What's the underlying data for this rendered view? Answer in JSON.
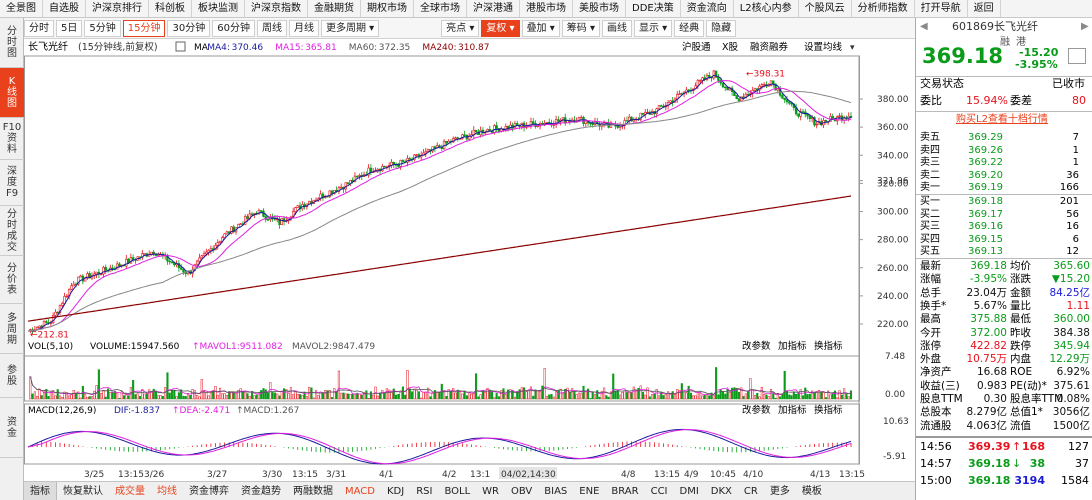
{
  "menu": [
    "全景图",
    "自选股",
    "沪深京排行",
    "科创板",
    "板块监测",
    "沪深京指数",
    "金融期货",
    "期权市场",
    "全球市场",
    "沪深港通",
    "港股市场",
    "美股市场",
    "DDE决策",
    "资金流向",
    "L2核心内参",
    "个股风云",
    "分析师指数",
    "打开导航",
    "返回"
  ],
  "left_tabs": [
    "分时图",
    "K线图",
    "F10资料",
    "深度F9",
    "分时成交",
    "分价表",
    "多周期",
    "参股",
    "资金"
  ],
  "toolbar": {
    "items": [
      "分时",
      "5日",
      "5分钟",
      "15分钟",
      "30分钟",
      "60分钟",
      "周线",
      "月线",
      "更多周期"
    ],
    "selected": "15分钟",
    "right_items": [
      "亮点",
      "复权",
      "叠加",
      "筹码",
      "画线",
      "显示",
      "经典",
      "隐藏"
    ]
  },
  "chart": {
    "stock_name": "长飞光纤",
    "period_note": "(15分钟线,前复权)",
    "ma": [
      {
        "label": "MA",
        "value": "",
        "color": "#000"
      },
      {
        "label": "MA4:",
        "value": "370.46",
        "color": "#1a1aa0"
      },
      {
        "label": "MA15:",
        "value": "365.81",
        "color": "#e020e0"
      },
      {
        "label": "MA60:",
        "value": "372.35",
        "color": "#555"
      },
      {
        "label": "MA240:",
        "value": "310.87",
        "color": "#8b0000"
      }
    ],
    "top_links": [
      "沪股通",
      "X股",
      "融资融券",
      "设置均线"
    ],
    "y_ticks": [
      "380.00",
      "360.00",
      "340.00",
      "321.96",
      "320.00",
      "300.00",
      "280.00",
      "260.00",
      "240.00",
      "220.00"
    ],
    "max_label": "398.31",
    "min_label": "212.81",
    "vol": {
      "title": "VOL(5,10)",
      "volume": "VOLUME:15947.560",
      "mavol1": "MAVOL1:9511.082",
      "mavol2": "MAVOL2:9847.479",
      "tools": [
        "改参数",
        "加指标",
        "换指标"
      ],
      "ticks": [
        "7.48",
        "0.00"
      ]
    },
    "macd": {
      "title": "MACD(12,26,9)",
      "dif": "DIF:-1.837",
      "dea": "DEA:-2.471",
      "macd": "MACD:1.267",
      "tools": [
        "改参数",
        "加指标",
        "换指标"
      ],
      "ticks": [
        "10.63",
        "-5.91"
      ]
    },
    "x_labels": [
      "3/25",
      "13:15",
      "3/26",
      "3/27",
      "3/30",
      "13:15",
      "3/31",
      "4/1",
      "4/2",
      "13:1",
      "04/02,14:30",
      "4/8",
      "13:15",
      "4/9",
      "10:45",
      "4/10",
      "4/13",
      "13:15"
    ]
  },
  "bottom_tabs": [
    "指标",
    "恢复默认",
    "成交量",
    "均线",
    "资金博弈",
    "资金趋势",
    "两融数据",
    "MACD",
    "KDJ",
    "RSI",
    "BOLL",
    "WR",
    "OBV",
    "BIAS",
    "ENE",
    "BRAR",
    "CCI",
    "DMI",
    "DKX",
    "CR",
    "更多",
    "模板"
  ],
  "quote": {
    "code": "601869",
    "name": "长飞光纤",
    "tags": [
      "融",
      "港"
    ],
    "price": "369.18",
    "change": "-15.20",
    "pct": "-3.95%",
    "status_label": "交易状态",
    "status": "已收市",
    "weibi_label": "委比",
    "weibi": "15.94%",
    "weicha_label": "委差",
    "weicha": "80",
    "l2_link": "购买L2查看十档行情",
    "sells": [
      {
        "l": "卖五",
        "p": "369.29",
        "v": "7"
      },
      {
        "l": "卖四",
        "p": "369.26",
        "v": "1"
      },
      {
        "l": "卖三",
        "p": "369.22",
        "v": "1"
      },
      {
        "l": "卖二",
        "p": "369.20",
        "v": "36"
      },
      {
        "l": "卖一",
        "p": "369.19",
        "v": "166"
      }
    ],
    "buys": [
      {
        "l": "买一",
        "p": "369.18",
        "v": "201"
      },
      {
        "l": "买二",
        "p": "369.17",
        "v": "56"
      },
      {
        "l": "买三",
        "p": "369.16",
        "v": "16"
      },
      {
        "l": "买四",
        "p": "369.15",
        "v": "6"
      },
      {
        "l": "买五",
        "p": "369.13",
        "v": "12"
      }
    ],
    "stats": [
      {
        "l1": "最新",
        "v1": "369.18",
        "c1": "green",
        "l2": "均价",
        "v2": "365.60",
        "c2": "green"
      },
      {
        "l1": "涨幅",
        "v1": "-3.95%",
        "c1": "green",
        "l2": "涨跌",
        "v2": "▼15.20",
        "c2": "green"
      },
      {
        "l1": "总手",
        "v1": "23.04万",
        "c1": "dark",
        "l2": "金额",
        "v2": "84.25亿",
        "c2": "blue"
      },
      {
        "l1": "换手*",
        "v1": "5.67%",
        "c1": "dark",
        "l2": "量比",
        "v2": "1.11",
        "c2": "red"
      },
      {
        "l1": "最高",
        "v1": "375.88",
        "c1": "green",
        "l2": "最低",
        "v2": "360.00",
        "c2": "green"
      },
      {
        "l1": "今开",
        "v1": "372.00",
        "c1": "green",
        "l2": "昨收",
        "v2": "384.38",
        "c2": "dark"
      },
      {
        "l1": "涨停",
        "v1": "422.82",
        "c1": "red",
        "l2": "跌停",
        "v2": "345.94",
        "c2": "green"
      },
      {
        "l1": "外盘",
        "v1": "10.75万",
        "c1": "red",
        "l2": "内盘",
        "v2": "12.29万",
        "c2": "green"
      },
      {
        "l1": "净资产",
        "v1": "16.68",
        "c1": "dark",
        "l2": "ROE",
        "v2": "6.92%",
        "c2": "dark"
      },
      {
        "l1": "收益(三)",
        "v1": "0.983",
        "c1": "dark",
        "l2": "PE(动)*",
        "v2": "375.61",
        "c2": "dark"
      },
      {
        "l1": "股息TTM",
        "v1": "0.30",
        "c1": "dark",
        "l2": "股息率TTM",
        "v2": "0.08%",
        "c2": "dark"
      },
      {
        "l1": "总股本",
        "v1": "8.279亿",
        "c1": "dark",
        "l2": "总值1*",
        "v2": "3056亿",
        "c2": "dark"
      },
      {
        "l1": "流通股",
        "v1": "4.063亿",
        "c1": "dark",
        "l2": "流值",
        "v2": "1500亿",
        "c2": "dark"
      }
    ],
    "ticks": [
      {
        "t": "14:56",
        "p": "369.39",
        "a": "↑",
        "v": "168",
        "n": "127",
        "pc": "red",
        "vc": "red"
      },
      {
        "t": "14:57",
        "p": "369.18",
        "a": "↓",
        "v": "38",
        "n": "37",
        "pc": "green",
        "vc": "green"
      },
      {
        "t": "15:00",
        "p": "369.18",
        "a": "",
        "v": "3194",
        "n": "1584",
        "pc": "green",
        "vc": "blue"
      }
    ]
  }
}
